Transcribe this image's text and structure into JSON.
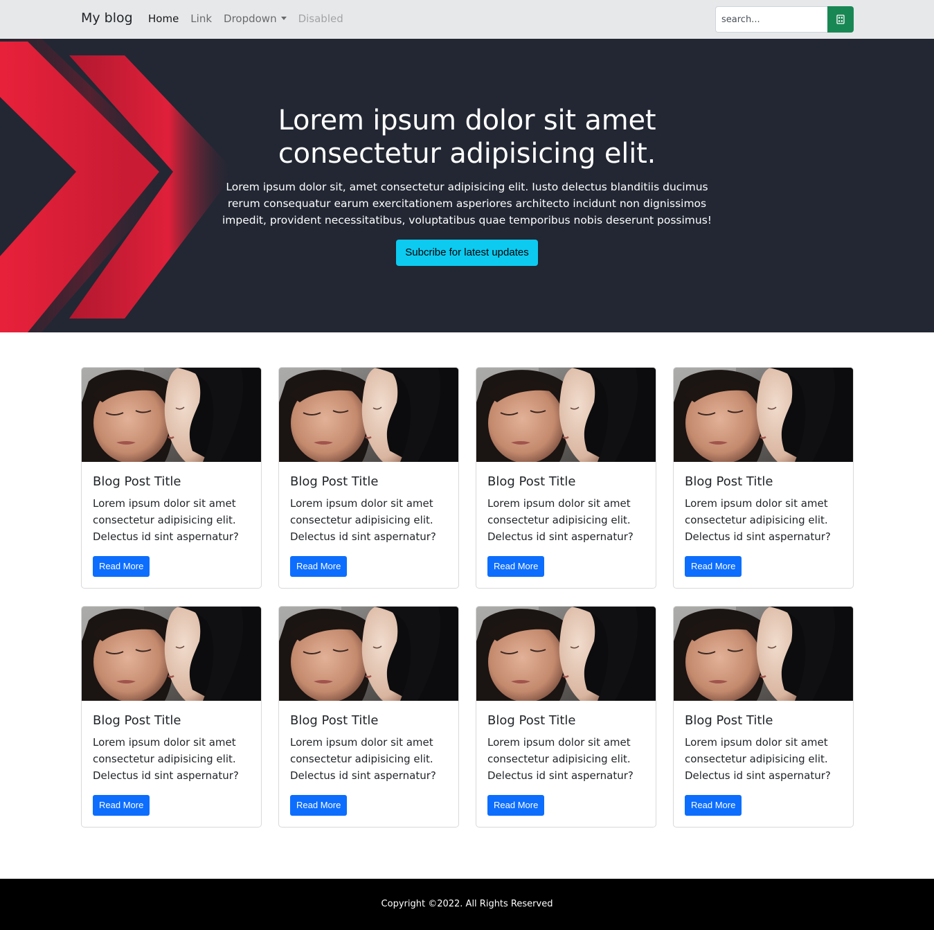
{
  "navbar": {
    "brand": "My blog",
    "links": [
      "Home",
      "Link",
      "Dropdown",
      "Disabled"
    ],
    "search_placeholder": "search..."
  },
  "hero": {
    "title": "Lorem ipsum dolor sit amet consectetur adipisicing elit.",
    "text": "Lorem ipsum dolor sit, amet consectetur adipisicing elit. Iusto delectus blanditiis ducimus rerum consequatur earum exercitationem asperiores architecto incidunt non dignissimos impedit, provident necessitatibus, voluptatibus quae temporibus nobis deserunt possimus!",
    "button": "Subcribe for latest updates"
  },
  "posts": [
    {
      "title": "Blog Post Title",
      "text": "Lorem ipsum dolor sit amet consectetur adipisicing elit. Delectus id sint aspernatur?",
      "button": "Read More"
    },
    {
      "title": "Blog Post Title",
      "text": "Lorem ipsum dolor sit amet consectetur adipisicing elit. Delectus id sint aspernatur?",
      "button": "Read More"
    },
    {
      "title": "Blog Post Title",
      "text": "Lorem ipsum dolor sit amet consectetur adipisicing elit. Delectus id sint aspernatur?",
      "button": "Read More"
    },
    {
      "title": "Blog Post Title",
      "text": "Lorem ipsum dolor sit amet consectetur adipisicing elit. Delectus id sint aspernatur?",
      "button": "Read More"
    },
    {
      "title": "Blog Post Title",
      "text": "Lorem ipsum dolor sit amet consectetur adipisicing elit. Delectus id sint aspernatur?",
      "button": "Read More"
    },
    {
      "title": "Blog Post Title",
      "text": "Lorem ipsum dolor sit amet consectetur adipisicing elit. Delectus id sint aspernatur?",
      "button": "Read More"
    },
    {
      "title": "Blog Post Title",
      "text": "Lorem ipsum dolor sit amet consectetur adipisicing elit. Delectus id sint aspernatur?",
      "button": "Read More"
    },
    {
      "title": "Blog Post Title",
      "text": "Lorem ipsum dolor sit amet consectetur adipisicing elit. Delectus id sint aspernatur?",
      "button": "Read More"
    }
  ],
  "footer": {
    "copyright": "Copyright ©2022. All Rights Reserved"
  },
  "colors": {
    "hero_bg": "#222733",
    "accent_red": "#e8213a",
    "subscribe_button": "#0dcaf0",
    "search_button": "#198754",
    "read_more_button": "#0d6efd",
    "footer_bg": "#000000"
  },
  "icons": {
    "search_button": "search-icon",
    "dropdown": "chevron-down-icon"
  }
}
